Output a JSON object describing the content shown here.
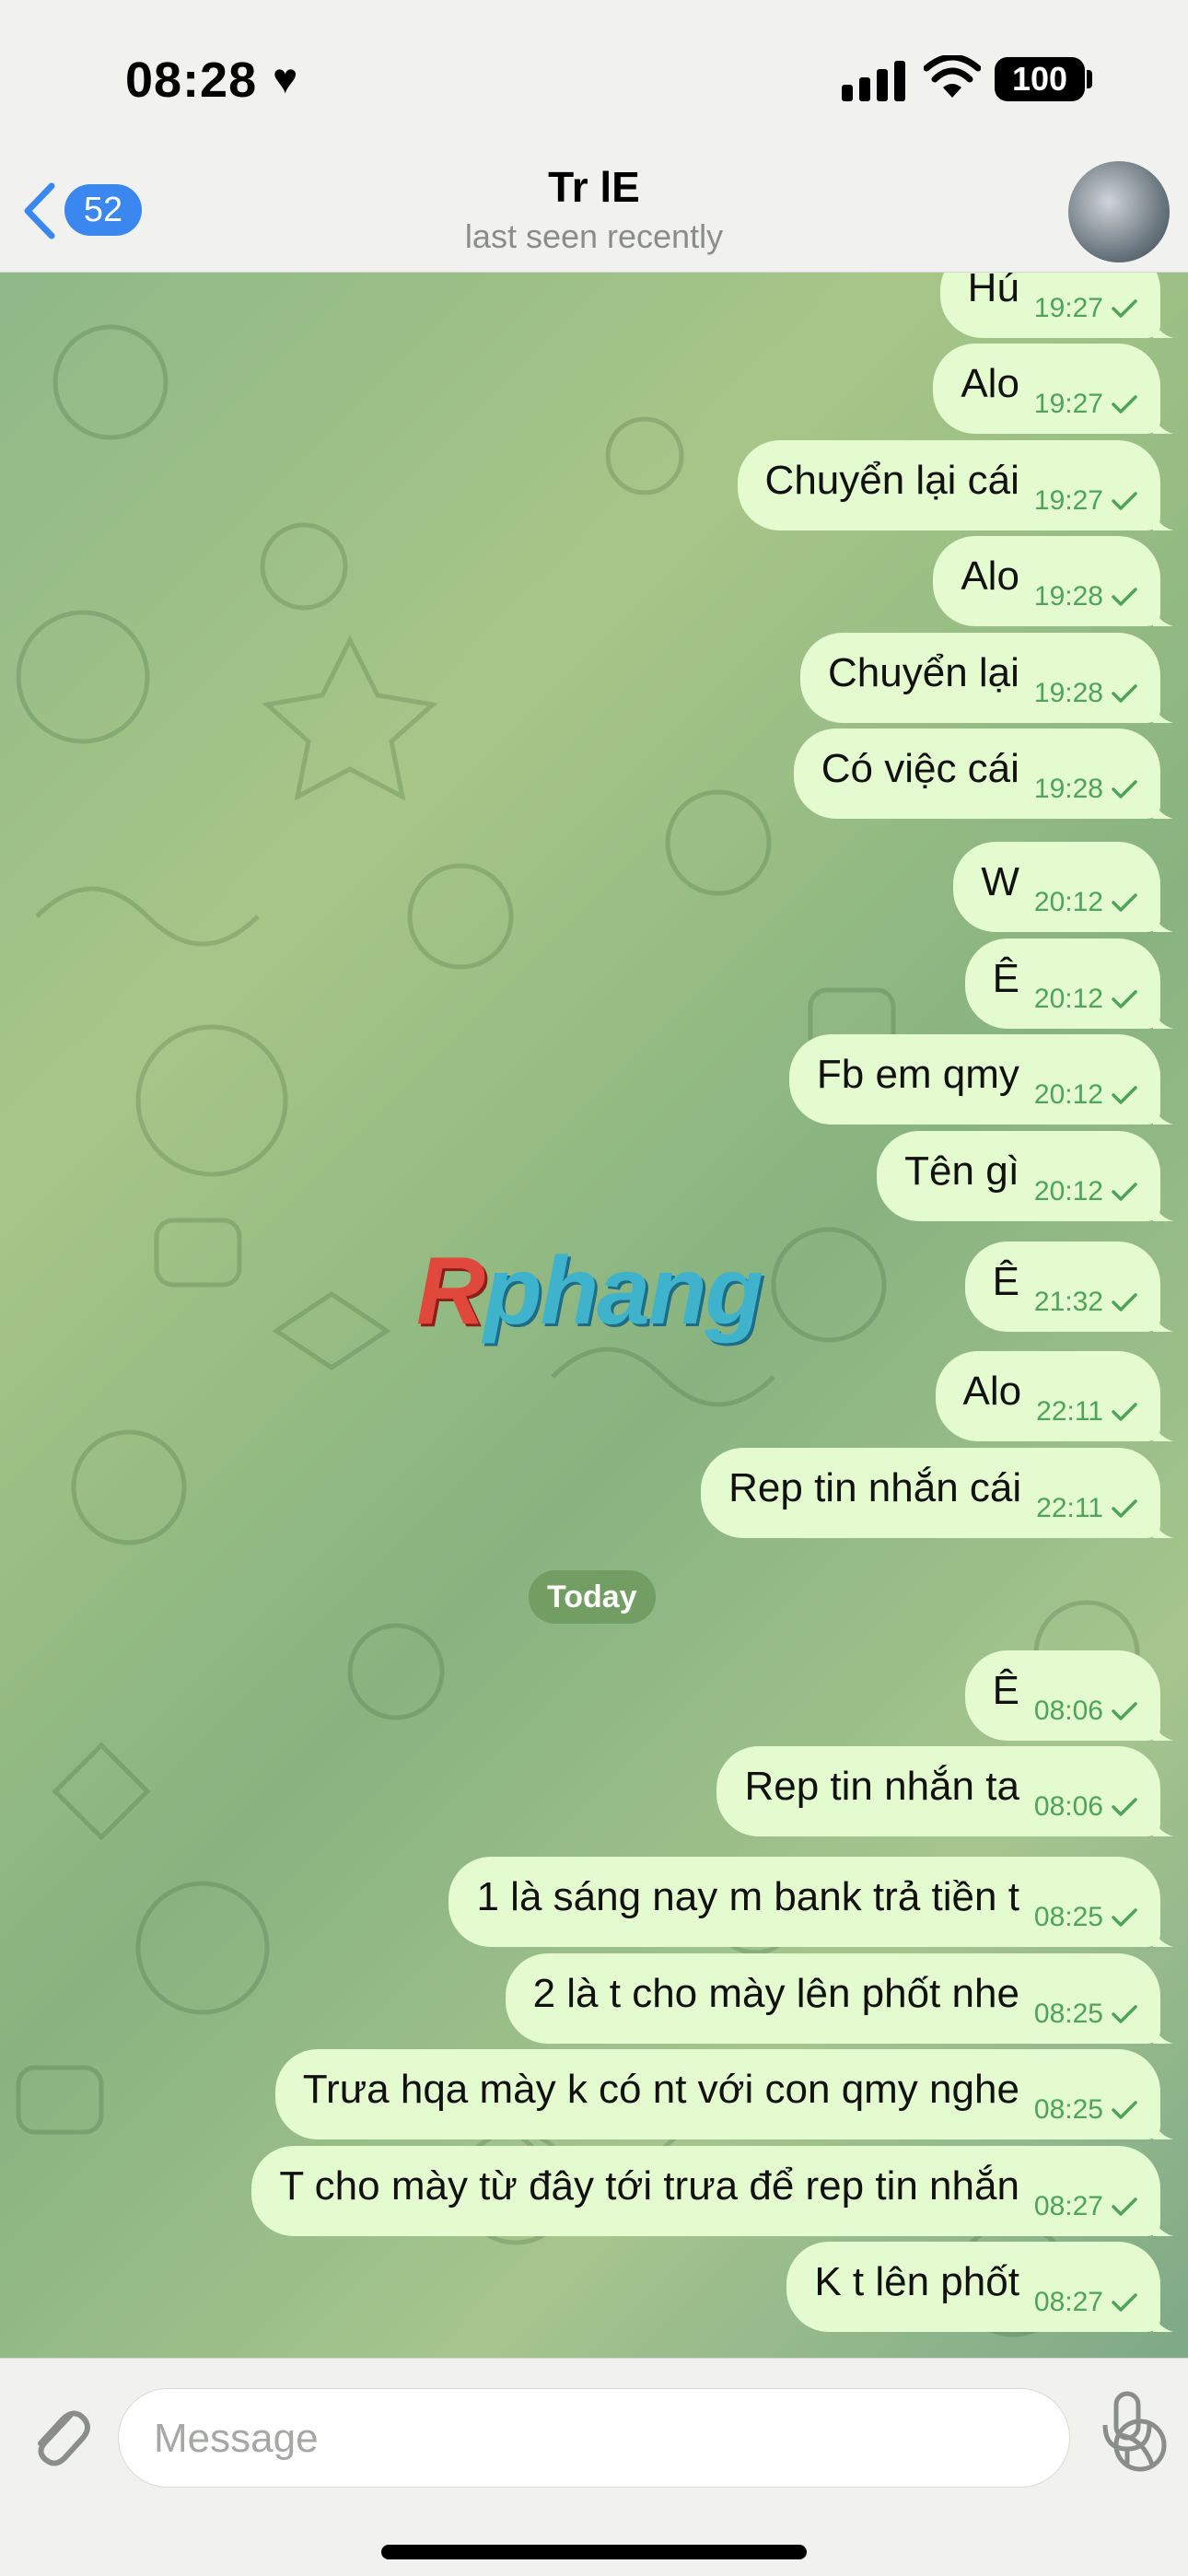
{
  "status": {
    "time": "08:28",
    "battery": "100"
  },
  "header": {
    "back_count": "52",
    "title": "Tr lE",
    "subtitle": "last seen recently"
  },
  "watermark": {
    "r": "R",
    "rest": "phang"
  },
  "date_separator": "Today",
  "messages": [
    {
      "text": "Hú",
      "time": "19:27"
    },
    {
      "text": "Alo",
      "time": "19:27"
    },
    {
      "text": "Chuyển lại cái",
      "time": "19:27"
    },
    {
      "text": "Alo",
      "time": "19:28"
    },
    {
      "text": "Chuyển lại",
      "time": "19:28"
    },
    {
      "text": "Có việc cái",
      "time": "19:28"
    },
    {
      "text": "W",
      "time": "20:12"
    },
    {
      "text": "Ê",
      "time": "20:12"
    },
    {
      "text": "Fb em qmy",
      "time": "20:12"
    },
    {
      "text": "Tên gì",
      "time": "20:12"
    },
    {
      "text": "Ê",
      "time": "21:32"
    },
    {
      "text": "Alo",
      "time": "22:11"
    },
    {
      "text": "Rep tin nhắn cái",
      "time": "22:11"
    },
    {
      "text": "Ê",
      "time": "08:06"
    },
    {
      "text": "Rep tin nhắn ta",
      "time": "08:06"
    },
    {
      "text": "1 là sáng nay m bank trả tiền t",
      "time": "08:25"
    },
    {
      "text": "2 là t cho mày lên phốt nhe",
      "time": "08:25"
    },
    {
      "text": "Trưa hqa mày k có nt với con qmy nghe",
      "time": "08:25"
    },
    {
      "text": "T cho mày từ đây tới trưa để rep tin nhắn",
      "time": "08:27"
    },
    {
      "text": "K t lên phốt",
      "time": "08:27"
    }
  ],
  "composer": {
    "placeholder": "Message"
  },
  "colors": {
    "bubble": "#e3fbcf",
    "meta": "#4fa35a",
    "accent": "#3a87f0",
    "date_pill": "#729e63"
  },
  "icons": [
    "heart-icon",
    "signal-icon",
    "wifi-icon",
    "back-chevron-icon",
    "attach-icon",
    "sticker-icon",
    "mic-icon"
  ]
}
